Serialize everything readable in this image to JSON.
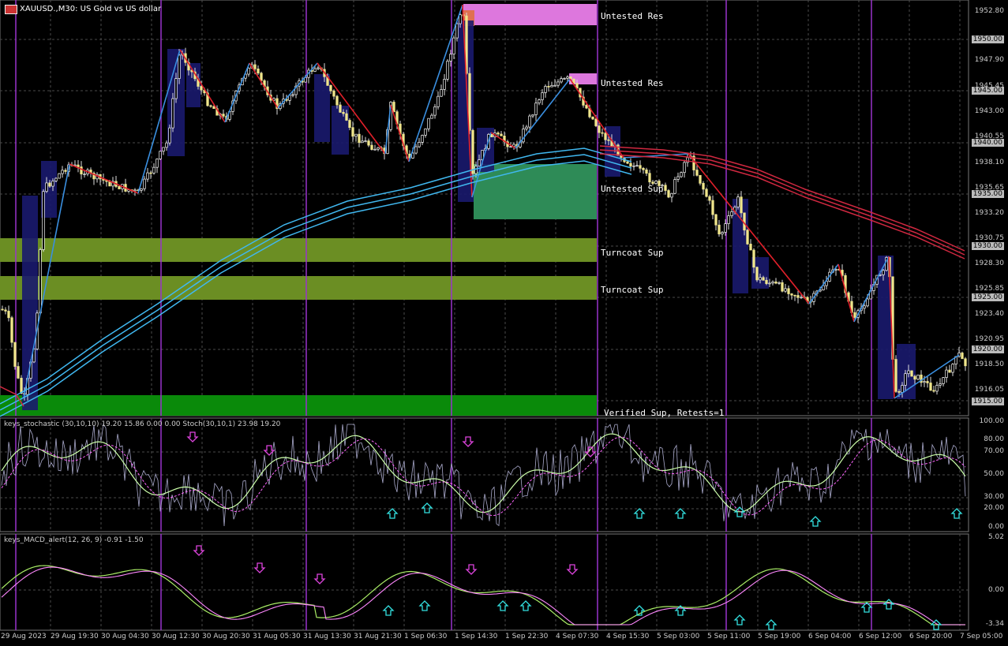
{
  "header": {
    "symbol": "XAUUSD.,M30:",
    "description": "US Gold vs US dollar",
    "flag_icon": "flag-icon"
  },
  "zones": {
    "untested_res_1": "Untested Res",
    "untested_res_2": "Untested Res",
    "untested_sup": "Untested Sup",
    "turncoat_sup_1": "Turncoat Sup",
    "turncoat_sup_2": "Turncoat Sup",
    "verified_sup": "Verified Sup, Retests=1"
  },
  "price_axis": {
    "ticks": [
      "1952.80",
      "1947.90",
      "1945.45",
      "1943.00",
      "1940.55",
      "1938.10",
      "1935.65",
      "1933.20",
      "1930.75",
      "1928.30",
      "1925.85",
      "1923.40",
      "1920.95",
      "1918.50",
      "1916.05"
    ],
    "boxed": [
      "1950.00",
      "1945.00",
      "1940.00",
      "1935.00",
      "1930.00",
      "1925.00",
      "1920.00",
      "1915.00"
    ]
  },
  "stoch_panel": {
    "title": "keys_stochastic (30,10,10) 19.20 15.86 0.00 0.00 Stoch(30,10,1) 23.98 19.20",
    "ticks": [
      "100.00",
      "80.00",
      "70.00",
      "50.00",
      "30.00",
      "20.00",
      "0.00"
    ]
  },
  "macd_panel": {
    "title": "keys_MACD_alert(12, 26, 9) -0.91 -1.50",
    "ticks": [
      "5.02",
      "0.00",
      "-3.34"
    ]
  },
  "time_axis": [
    "29 Aug 2023",
    "29 Aug 19:30",
    "30 Aug 04:30",
    "30 Aug 12:30",
    "30 Aug 20:30",
    "31 Aug 05:30",
    "31 Aug 13:30",
    "31 Aug 21:30",
    "1 Sep 06:30",
    "1 Sep 14:30",
    "1 Sep 22:30",
    "4 Sep 07:30",
    "4 Sep 15:30",
    "5 Sep 03:00",
    "5 Sep 11:00",
    "5 Sep 19:00",
    "6 Sep 04:00",
    "6 Sep 12:00",
    "6 Sep 20:00",
    "7 Sep 05:00"
  ],
  "colors": {
    "background": "#000000",
    "grid": "#4a4a4a",
    "period_separator": "#9933cc",
    "resistance_zone": "#dd77dd",
    "support_zone_weak": "#2e8b57",
    "turncoat_zone": "#6b8e23",
    "verified_zone": "#0a8a0a",
    "zigzag_up": "#3a8fe0",
    "zigzag_down": "#e0202a",
    "ma_blue": "#40b8f0",
    "ma_red": "#d02840",
    "stoch_main": "#ccffaa",
    "stoch_signal": "#ff66ff",
    "arrow_up": "#33e0e0",
    "arrow_down": "#dd44dd"
  }
}
